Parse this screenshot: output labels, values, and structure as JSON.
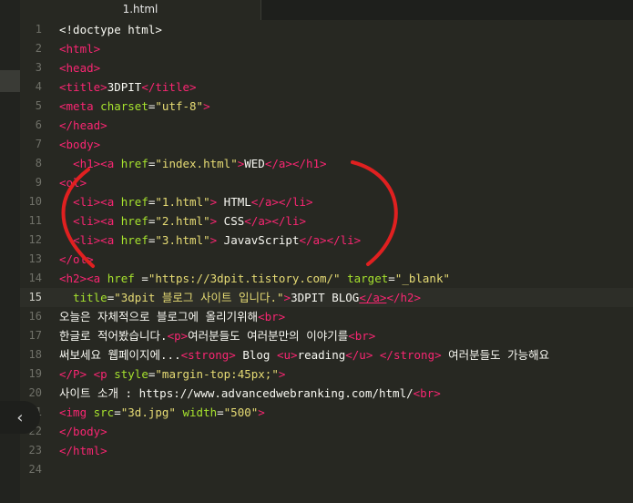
{
  "tab": {
    "title": "1.html"
  },
  "gutter": {
    "lines": [
      "1",
      "2",
      "3",
      "4",
      "5",
      "6",
      "7",
      "8",
      "9",
      "10",
      "11",
      "12",
      "13",
      "14",
      "15",
      "16",
      "17",
      "18",
      "19",
      "20",
      "21",
      "22",
      "23",
      "24"
    ]
  },
  "code": {
    "l1": [
      "<!doctype html>"
    ],
    "l2": [
      "<html>"
    ],
    "l3": [
      "<head>"
    ],
    "l4": [
      "<title>",
      "3DPIT",
      "</title>"
    ],
    "l5": [
      "<meta",
      " charset",
      "=",
      "\"utf-8\"",
      ">"
    ],
    "l6": [
      "</head>"
    ],
    "l7": [
      "<body>"
    ],
    "l8": [
      "  ",
      "<h1>",
      "<a",
      " href",
      "=",
      "\"index.html\"",
      ">",
      "WED",
      "</a>",
      "</h1>"
    ],
    "l9": [
      "<ol>"
    ],
    "l10": [
      "  ",
      "<li>",
      "<a",
      " href",
      "=",
      "\"1.html\"",
      ">",
      " HTML",
      "</a>",
      "</li>"
    ],
    "l11": [
      "  ",
      "<li>",
      "<a",
      " href",
      "=",
      "\"2.html\"",
      ">",
      " CSS",
      "</a>",
      "</li>"
    ],
    "l12": [
      "  ",
      "<li>",
      "<a",
      " href",
      "=",
      "\"3.html\"",
      ">",
      " JavavScript",
      "</a>",
      "</li>"
    ],
    "l13": [
      "</ol>"
    ],
    "l14": [
      "<h2>",
      "<a",
      " href ",
      "=",
      "\"https://3dpit.tistory.com/\"",
      " target",
      "=",
      "\"_blank\""
    ],
    "l15": [
      "  ",
      "title",
      "=",
      "\"3dpit 블로그 사이트 입니다.\"",
      ">",
      "3DPIT BLOG",
      "</a>",
      "</h2>"
    ],
    "l16": [
      "오늘은 자체적으로 블로그에 올리기위해",
      "<br>"
    ],
    "l17": [
      "한글로 적어봤습니다.",
      "<p>",
      "여러분들도 여러분만의 이야기를",
      "<br>"
    ],
    "l18": [
      "써보세요 웹페이지에...",
      "<strong>",
      " Blog ",
      "<u>",
      "reading",
      "</u>",
      " ",
      "</strong>",
      " 여러분들도 가능해요"
    ],
    "l19": [
      "</P>",
      " ",
      "<p",
      " style",
      "=",
      "\"margin-top:45px;\"",
      ">"
    ],
    "l20": [
      "사이트 소개 : https://www.advancedwebranking.com/html/",
      "<br>"
    ],
    "l21": [
      "<img",
      " src",
      "=",
      "\"3d.jpg\"",
      " width",
      "=",
      "\"500\"",
      ">"
    ],
    "l22": [
      "</body>"
    ],
    "l23": [
      "</html>"
    ],
    "l24": []
  },
  "colors": {
    "background": "#272822",
    "tag": "#f92672",
    "attribute": "#a6e22e",
    "string": "#e6db74",
    "text": "#f8f8f2",
    "annotation": "#e02020"
  },
  "icons": {
    "collapse": "chevron-left-icon"
  }
}
